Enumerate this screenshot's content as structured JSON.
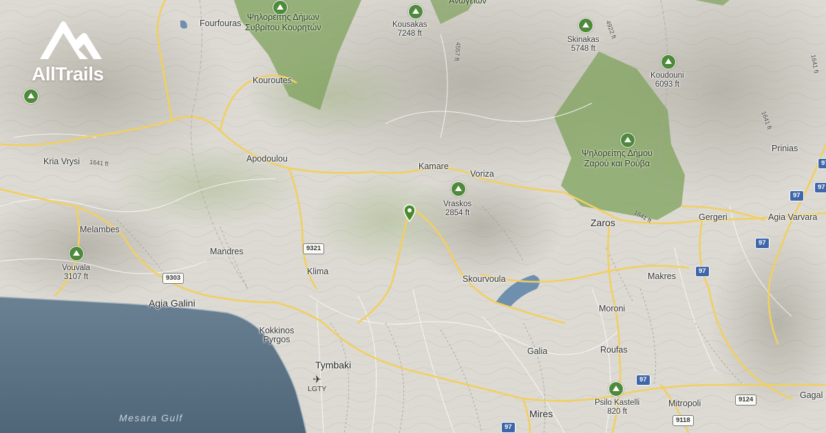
{
  "brand": {
    "name": "AllTrails",
    "icon": "mountain-logo-icon"
  },
  "colors": {
    "land": "#dcdad3",
    "sea": "#5b7488",
    "forest": "#7fa15c",
    "road_major": "#f2cf60",
    "pin": "#4a8a2e"
  },
  "forests": [
    {
      "line1": "Ψηλορείτης Δήμων",
      "line2": "Συβρίτου Κουρητών"
    },
    {
      "line1": "Ψηλορείτης Δήμου",
      "line2": "Ζαρού και Ρούβα"
    },
    {
      "line1": "Ανωγείων"
    }
  ],
  "peaks": [
    {
      "name": "Kousakas",
      "elevation": "7248 ft"
    },
    {
      "name": "Skinakas",
      "elevation": "5748 ft"
    },
    {
      "name": "Koudouni",
      "elevation": "6093 ft"
    },
    {
      "name": "Vraskos",
      "elevation": "2854 ft"
    },
    {
      "name": "Vouvala",
      "elevation": "3107 ft"
    },
    {
      "name": "Psilo Kastelli",
      "elevation": "820 ft"
    }
  ],
  "places": [
    "Fourfouras",
    "Kouroutes",
    "Kria Vrysi",
    "Apodoulou",
    "Kamare",
    "Voriza",
    "Melambes",
    "Mandres",
    "Klima",
    "Skourvoula",
    "Zaros",
    "Gergeri",
    "Prinias",
    "Agia Varvara",
    "Makres",
    "Moroni",
    "Agia Galini",
    "Kokkinos Pyrgos",
    "Tymbaki",
    "Galia",
    "Roufas",
    "Mires",
    "Mitropoli",
    "Gagal"
  ],
  "routes": [
    "9321",
    "9303",
    "97",
    "97",
    "97",
    "97",
    "97",
    "9124",
    "9118",
    "97",
    "97"
  ],
  "elevation_labels": [
    "1641 ft",
    "4922 ft",
    "4557 ft",
    "1641 ft",
    "1641 ft",
    "1641 ft"
  ],
  "water": {
    "name": "Mesara Gulf"
  },
  "airport": {
    "code": "LGTY",
    "icon": "airplane-icon"
  },
  "marker": {
    "icon": "trail-pin-icon"
  }
}
